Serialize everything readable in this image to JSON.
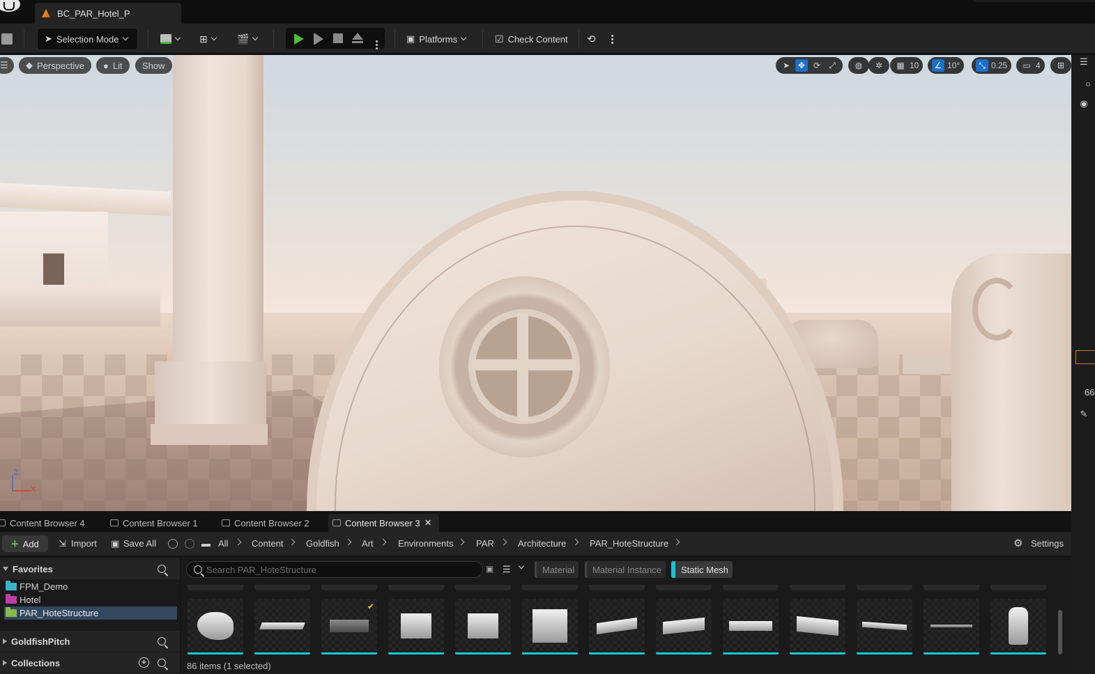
{
  "window": {
    "level_tab": "BC_PAR_Hotel_P"
  },
  "toolbar": {
    "selection_mode": "Selection Mode",
    "platforms": "Platforms",
    "check_content": "Check Content"
  },
  "viewport": {
    "perspective": "Perspective",
    "lit": "Lit",
    "show": "Show",
    "grid_snap": "10",
    "rotation_snap": "10°",
    "scale_snap": "0.25",
    "camera_speed": "4",
    "axis_z": "Z",
    "axis_x": "X"
  },
  "right_strip": {
    "partial_number": "66"
  },
  "content_browser": {
    "tabs": [
      {
        "label": "Content Browser 4",
        "active": false
      },
      {
        "label": "Content Browser 1",
        "active": false
      },
      {
        "label": "Content Browser 2",
        "active": false
      },
      {
        "label": "Content Browser 3",
        "active": true
      }
    ],
    "add": "Add",
    "import": "Import",
    "save_all": "Save All",
    "settings": "Settings",
    "breadcrumb": [
      "All",
      "Content",
      "Goldfish",
      "Art",
      "Environments",
      "PAR",
      "Architecture",
      "PAR_HoteStructure"
    ],
    "search_placeholder": "Search PAR_HoteStructure",
    "filters": [
      {
        "label": "Material",
        "active": false
      },
      {
        "label": "Material Instance",
        "active": false
      },
      {
        "label": "Static Mesh",
        "active": true
      }
    ],
    "status": "86 items (1 selected)"
  },
  "sources": {
    "favorites_header": "Favorites",
    "favorites": [
      {
        "label": "FPM_Demo",
        "color": "#35b5c8",
        "selected": false
      },
      {
        "label": "Hotel",
        "color": "#c03aa8",
        "selected": false
      },
      {
        "label": "PAR_HoteStructure",
        "color": "#8ab84a",
        "selected": true
      }
    ],
    "goldfish_header": "GoldfishPitch",
    "collections_header": "Collections"
  },
  "colors": {
    "accent_blue": "#1a70c8",
    "static_mesh_cyan": "#16c6d4",
    "play_green": "#4ac03a"
  }
}
